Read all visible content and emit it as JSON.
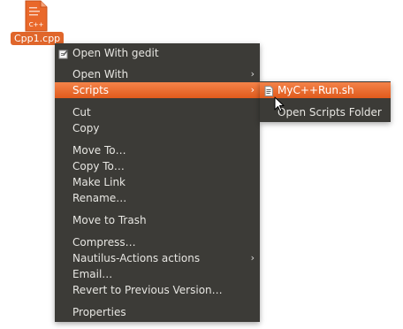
{
  "desktop": {
    "file_name": "Cpp1.cpp",
    "file_icon_text": "C++",
    "file_icon_name": "cpp-source-file-icon"
  },
  "context_menu": {
    "items": [
      {
        "label": "Open With gedit",
        "icon": "gedit-icon"
      },
      {
        "label": "Open With",
        "has_submenu": true
      },
      {
        "label": "Scripts",
        "has_submenu": true,
        "highlighted": true
      },
      {
        "label": "Cut"
      },
      {
        "label": "Copy"
      },
      {
        "label": "Move To…"
      },
      {
        "label": "Copy To…"
      },
      {
        "label": "Make Link"
      },
      {
        "label": "Rename…"
      },
      {
        "label": "Move to Trash"
      },
      {
        "label": "Compress…"
      },
      {
        "label": "Nautilus-Actions actions",
        "has_submenu": true
      },
      {
        "label": "Email…"
      },
      {
        "label": "Revert to Previous Version…"
      },
      {
        "label": "Properties"
      }
    ],
    "submenu_arrow": "›"
  },
  "scripts_submenu": {
    "items": [
      {
        "label": "MyC++Run.sh",
        "icon": "script-file-icon",
        "highlighted": true
      },
      {
        "label": "Open Scripts Folder"
      }
    ]
  },
  "colors": {
    "menu_bg": "#3c3b37",
    "highlight": "#e9682a",
    "menu_text": "#e7e6e2"
  }
}
